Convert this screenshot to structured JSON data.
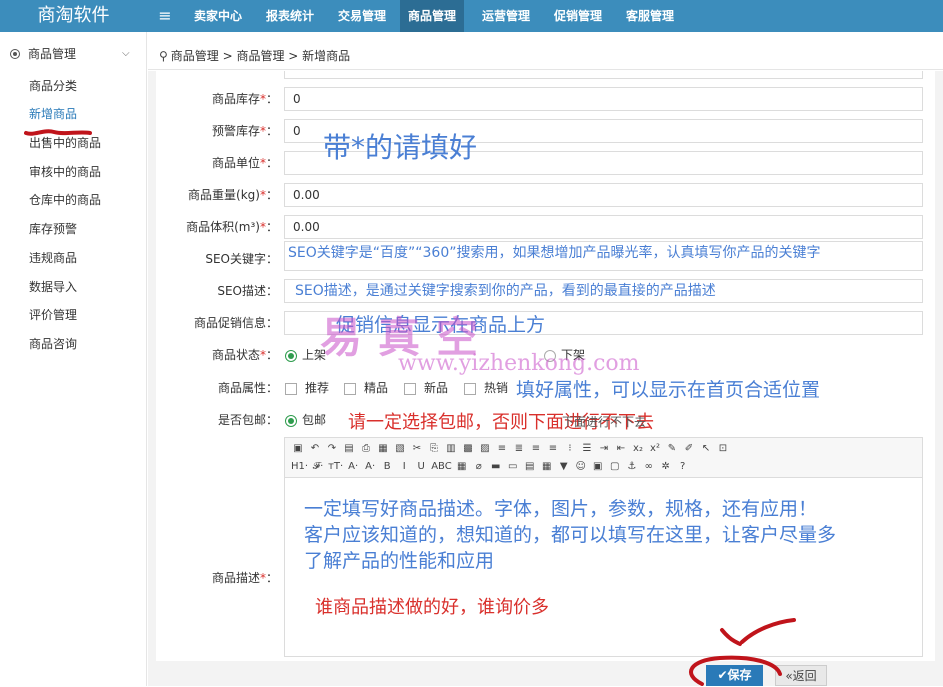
{
  "header": {
    "brand": "商淘软件",
    "menu_icon": "hamburger-icon",
    "nav": [
      "卖家中心",
      "报表统计",
      "交易管理",
      "商品管理",
      "运营管理",
      "促销管理",
      "客服管理"
    ],
    "active_nav": "商品管理",
    "color": "#3c8dbc"
  },
  "sidebar": {
    "section": "商品管理",
    "items": [
      "商品分类",
      "新增商品",
      "出售中的商品",
      "审核中的商品",
      "仓库中的商品",
      "库存预警",
      "违规商品",
      "数据导入",
      "评价管理",
      "商品咨询"
    ],
    "active": "新增商品"
  },
  "breadcrumb": {
    "icon": "location-pin-icon",
    "text": "商品管理 > 商品管理 > 新增商品"
  },
  "form": {
    "stock": {
      "label": "商品库存",
      "value": "0"
    },
    "warn_stock": {
      "label": "预警库存",
      "value": "0"
    },
    "unit": {
      "label": "商品单位",
      "value": ""
    },
    "weight": {
      "label": "商品重量(kg)",
      "value": "0.00"
    },
    "volume": {
      "label": "商品体积(m³)",
      "value": "0.00"
    },
    "seo_keywords": {
      "label": "SEO关键字：",
      "value": "SEO关键字是“百度”“360”搜索用，如果想增加产品曝光率，认真填写你产品的关键字"
    },
    "seo_desc": {
      "label": "SEO描述：",
      "value": "SEO描述，是通过关键字搜索到你的产品，看到的最直接的产品描述"
    },
    "promo": {
      "label": "商品促销信息：",
      "value": ""
    },
    "status": {
      "label": "商品状态",
      "options": [
        "上架",
        "下架"
      ],
      "selected": "上架"
    },
    "attrs": {
      "label": "商品属性：",
      "options": [
        "推荐",
        "精品",
        "新品",
        "热销"
      ]
    },
    "shipping": {
      "label": "是否包邮：",
      "options": [
        "包邮"
      ],
      "selected": "包邮"
    },
    "desc": {
      "label": "商品描述"
    },
    "required_mark": "*",
    "colon": "："
  },
  "editor": {
    "toolbar_row1": [
      "▣",
      "↶",
      "↷",
      "▤",
      "⎙",
      "▦",
      "▧",
      "✂",
      "⎘",
      "▥",
      "▩",
      "▨",
      "≡",
      "≣",
      "≡",
      "≡",
      "⁝",
      "☰",
      "⇥",
      "⇤",
      "x₂",
      "x²",
      "✎",
      "✐",
      "↖",
      "⊡"
    ],
    "toolbar_row2": [
      "H1·",
      "𝓕·",
      "тT·",
      "A·",
      "A·",
      "B",
      "I",
      "U",
      "ABC",
      "▦",
      "⌀",
      "▬",
      "▭",
      "▤",
      "▦",
      "▼",
      "☺",
      "▣",
      "▢",
      "⚓",
      "∞",
      "✲",
      "?"
    ]
  },
  "annotations": {
    "required_hint": "带*的请填好",
    "promo_hint": "促销信息显示在商品上方",
    "attr_hint": "填好属性，可以显示在首页合适位置",
    "ship_hint": "请一定选择包邮，否则下面进行不下去",
    "desc_hint_1": "一定填写好商品描述。字体，图片，参数，规格，还有应用！",
    "desc_hint_2": "客户应该知道的，想知道的，都可以填写在这里，让客户尽量多",
    "desc_hint_3": "了解产品的性能和应用",
    "desc_hint_4": "谁商品描述做的好，谁询价多",
    "overlap_text": "下面进行不下去"
  },
  "watermark": {
    "cn": "易真空",
    "url": "www.yizhenkong.com"
  },
  "buttons": {
    "save": "✔保存",
    "back": "«返回"
  }
}
